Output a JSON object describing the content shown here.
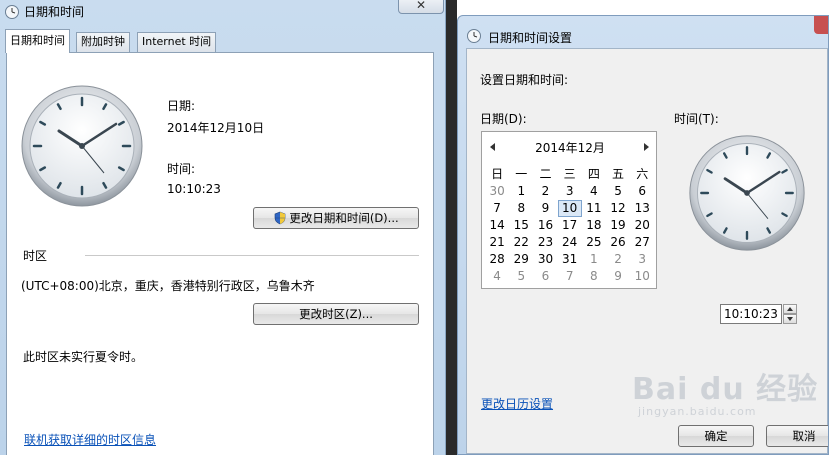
{
  "left_window": {
    "title": "日期和时间",
    "close_glyph": "✕",
    "tabs": [
      "日期和时间",
      "附加时钟",
      "Internet 时间"
    ],
    "date_label": "日期:",
    "date_value": "2014年12月10日",
    "time_label": "时间:",
    "time_value": "10:10:23",
    "change_datetime_button": "更改日期和时间(D)...",
    "timezone_header": "时区",
    "timezone_value": "(UTC+08:00)北京，重庆，香港特别行政区，乌鲁木齐",
    "change_timezone_button": "更改时区(Z)...",
    "dst_note": "此时区未实行夏令时。",
    "link_online_tz": "联机获取详细的时区信息"
  },
  "right_window": {
    "title": "日期和时间设置",
    "heading": "设置日期和时间:",
    "date_label": "日期(D):",
    "time_label": "时间(T):",
    "calendar": {
      "month_title": "2014年12月",
      "weekdays": [
        "日",
        "一",
        "二",
        "三",
        "四",
        "五",
        "六"
      ],
      "rows": [
        [
          "30",
          "1",
          "2",
          "3",
          "4",
          "5",
          "6"
        ],
        [
          "7",
          "8",
          "9",
          "10",
          "11",
          "12",
          "13"
        ],
        [
          "14",
          "15",
          "16",
          "17",
          "18",
          "19",
          "20"
        ],
        [
          "21",
          "22",
          "23",
          "24",
          "25",
          "26",
          "27"
        ],
        [
          "28",
          "29",
          "30",
          "31",
          "1",
          "2",
          "3"
        ],
        [
          "4",
          "5",
          "6",
          "7",
          "8",
          "9",
          "10"
        ]
      ],
      "selected_day": "10"
    },
    "time_value": "10:10:23",
    "link_calendar_settings": "更改日历设置",
    "ok_button": "确定",
    "cancel_button": "取消"
  },
  "watermark": {
    "main": "Bai du 经验",
    "sub": "jingyan.baidu.com"
  },
  "colors": {
    "link": "#0a52b8",
    "title_bar": "#c9dcef",
    "dialog_bg": "#f0f0f0"
  },
  "icons": [
    "datetime-icon",
    "clock-face-icon",
    "shield-uac-icon",
    "calendar-prev-icon",
    "calendar-next-icon",
    "spin-up-icon",
    "spin-down-icon",
    "close-icon"
  ]
}
